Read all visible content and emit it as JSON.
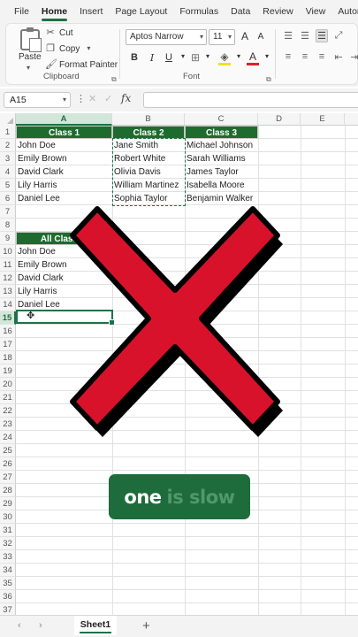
{
  "menu": {
    "items": [
      "File",
      "Home",
      "Insert",
      "Page Layout",
      "Formulas",
      "Data",
      "Review",
      "View",
      "Automa"
    ],
    "active": "Home"
  },
  "ribbon": {
    "clipboard": {
      "paste": "Paste",
      "cut": "Cut",
      "copy": "Copy",
      "format_painter": "Format Painter",
      "label": "Clipboard"
    },
    "font": {
      "font_name": "Aptos Narrow",
      "font_size": "11",
      "bold": "B",
      "italic": "I",
      "underline": "U",
      "font_color_letter": "A",
      "label": "Font",
      "increase_size": "A",
      "decrease_size": "A"
    }
  },
  "formula_bar": {
    "name_box": "A15",
    "fx": "fx",
    "content": ""
  },
  "columns": [
    "A",
    "B",
    "C",
    "D",
    "E"
  ],
  "rows": [
    "1",
    "2",
    "3",
    "4",
    "5",
    "6",
    "7",
    "8",
    "9",
    "10",
    "11",
    "12",
    "13",
    "14",
    "15",
    "16",
    "17",
    "18",
    "19",
    "20",
    "21",
    "22",
    "23",
    "24",
    "25",
    "26",
    "27",
    "28",
    "29",
    "30",
    "31",
    "32",
    "33",
    "34",
    "35",
    "36",
    "37"
  ],
  "table": {
    "headers": [
      "Class 1",
      "Class 2",
      "Class 3"
    ],
    "class1": [
      "John Doe",
      "Emily Brown",
      "David Clark",
      "Lily Harris",
      "Daniel Lee"
    ],
    "class2": [
      "Jane Smith",
      "Robert White",
      "Olivia Davis",
      "William Martinez",
      "Sophia Taylor"
    ],
    "class3": [
      "Michael Johnson",
      "Sarah Williams",
      "James Taylor",
      "Isabella Moore",
      "Benjamin Walker"
    ]
  },
  "all_classes": {
    "header": "All Classes",
    "names": [
      "John Doe",
      "Emily Brown",
      "David Clark",
      "Lily Harris",
      "Daniel Lee"
    ]
  },
  "overlay": {
    "badge_word1": "one",
    "badge_word2": "is slow",
    "x_color": "#d9122b"
  },
  "sheets": {
    "active": "Sheet1",
    "add": "+"
  },
  "colors": {
    "accent": "#1e7145",
    "header_fill": "#1e6b2f"
  }
}
